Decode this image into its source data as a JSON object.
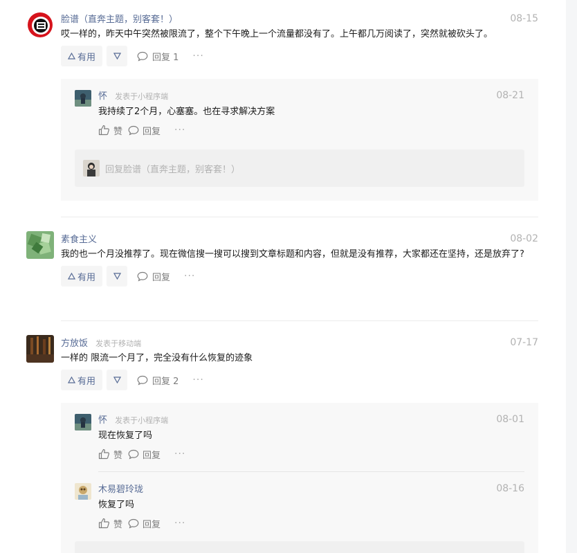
{
  "labels": {
    "useful": "有用",
    "reply": "回复",
    "like": "赞",
    "more": "···"
  },
  "icons": {
    "useful": "triangle-up-icon",
    "down": "triangle-down-icon",
    "reply": "speech-bubble-icon",
    "like": "thumbs-up-icon"
  },
  "colors": {
    "name": "#576b95",
    "meta": "#b2b2b2",
    "panel": "#f8f8f8"
  },
  "comments": [
    {
      "user": "脸谱（直奔主题，别客套！）",
      "date": "08-15",
      "text": "哎一样的，昨天中午突然被限流了，整个下午晚上一个流量都没有了。上午都几万阅读了，突然就被砍头了。",
      "reply_label": "回复 1",
      "replies": [
        {
          "user": "怀",
          "via": "发表于小程序端",
          "date": "08-21",
          "text": "我持续了2个月，心塞塞。也在寻求解决方案"
        }
      ],
      "reply_input_placeholder": "回复脸谱（直奔主题，别客套！）"
    },
    {
      "user": "素食主义",
      "date": "08-02",
      "text": "我的也一个月没推荐了。现在微信搜一搜可以搜到文章标题和内容，但就是没有推荐，大家都还在坚持，还是放弃了?",
      "reply_label": "回复"
    },
    {
      "user": "方放饭",
      "via": "发表于移动端",
      "date": "07-17",
      "text": "一样的 限流一个月了，完全没有什么恢复的迹象",
      "reply_label": "回复 2",
      "replies": [
        {
          "user": "怀",
          "via": "发表于小程序端",
          "date": "08-01",
          "text": "现在恢复了吗"
        },
        {
          "user": "木易碧玲珑",
          "date": "08-16",
          "text": "恢复了吗"
        }
      ]
    }
  ]
}
